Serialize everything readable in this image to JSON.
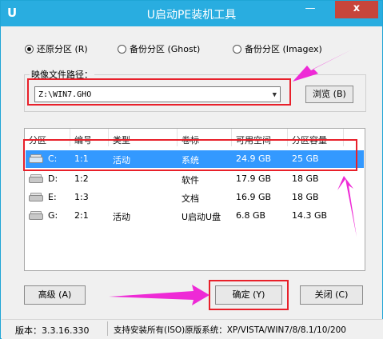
{
  "window": {
    "title": "U启动PE装机工具",
    "app_icon": "U",
    "minimize": "—",
    "close": "x"
  },
  "radios": [
    {
      "label": "还原分区 (R)",
      "checked": true
    },
    {
      "label": "备份分区 (Ghost)",
      "checked": false
    },
    {
      "label": "备份分区 (Imagex)",
      "checked": false
    }
  ],
  "image_path": {
    "label": "映像文件路径：",
    "value": "Z:\\WIN7.GHO",
    "browse": "浏览 (B)"
  },
  "table": {
    "headers": [
      "分区",
      "编号",
      "类型",
      "卷标",
      "可用空间",
      "分区容量"
    ],
    "rows": [
      {
        "part": "C:",
        "num": "1:1",
        "type": "活动",
        "label": "系统",
        "free": "24.9 GB",
        "size": "25 GB",
        "selected": true,
        "icon": "disk-drive-icon"
      },
      {
        "part": "D:",
        "num": "1:2",
        "type": "",
        "label": "软件",
        "free": "17.9 GB",
        "size": "18 GB",
        "selected": false,
        "icon": "disk-drive-icon"
      },
      {
        "part": "E:",
        "num": "1:3",
        "type": "",
        "label": "文档",
        "free": "16.9 GB",
        "size": "18 GB",
        "selected": false,
        "icon": "disk-drive-icon"
      },
      {
        "part": "G:",
        "num": "2:1",
        "type": "活动",
        "label": "U启动U盘",
        "free": "6.8 GB",
        "size": "14.3 GB",
        "selected": false,
        "icon": "usb-drive-icon"
      }
    ]
  },
  "buttons": {
    "advanced": "高级 (A)",
    "confirm": "确定 (Y)",
    "close": "关闭 (C)"
  },
  "status": {
    "version": "版本：3.3.16.330",
    "support": "支持安装所有(ISO)原版系统：XP/VISTA/WIN7/8/8.1/10/200"
  },
  "colors": {
    "titlebar": "#29ade0",
    "selection": "#3399ff",
    "annotation_red": "#e8202a",
    "annotation_magenta": "#ee2ad6"
  }
}
